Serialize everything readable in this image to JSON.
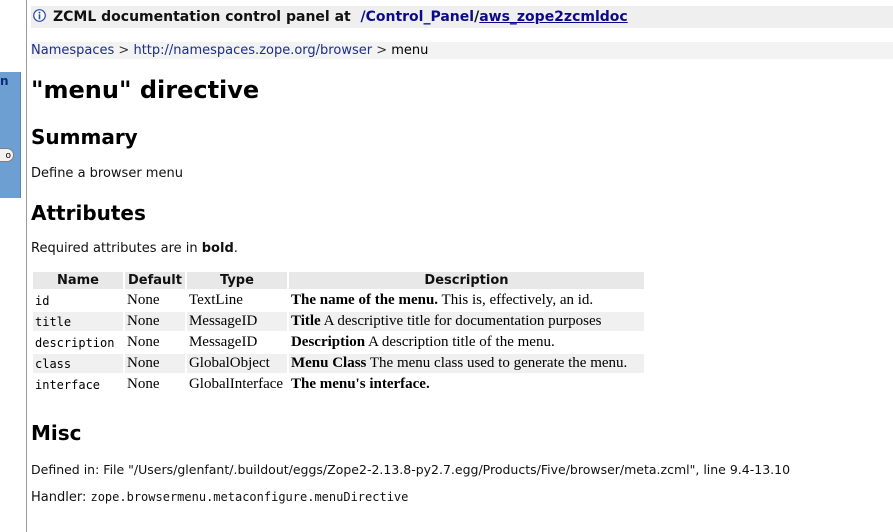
{
  "left_panel": {
    "letter_fragment": "n",
    "button_fragment": "o"
  },
  "header": {
    "prefix": "ZCML documentation control panel at",
    "link_control_panel": "/Control_Panel",
    "slash": "/",
    "link_doc": "aws_zope2zcmldoc"
  },
  "breadcrumb": {
    "item1": "Namespaces",
    "sep": ">",
    "item2": "http://namespaces.zope.org/browser",
    "item3": "menu"
  },
  "page": {
    "title": "\"menu\" directive"
  },
  "summary": {
    "heading": "Summary",
    "text": "Define a browser menu"
  },
  "attributes": {
    "heading": "Attributes",
    "note_prefix": "Required attributes are in",
    "note_bold": "bold",
    "note_suffix": ".",
    "columns": [
      "Name",
      "Default",
      "Type",
      "Description"
    ],
    "rows": [
      {
        "name": "id",
        "default": "None",
        "type": "TextLine",
        "desc_bold": "The name of the menu.",
        "desc": " This is, effectively, an id."
      },
      {
        "name": "title",
        "default": "None",
        "type": "MessageID",
        "desc_bold": "Title",
        "desc": " A descriptive title for documentation purposes"
      },
      {
        "name": "description",
        "default": "None",
        "type": "MessageID",
        "desc_bold": "Description",
        "desc": " A description title of the menu."
      },
      {
        "name": "class",
        "default": "None",
        "type": "GlobalObject",
        "desc_bold": "Menu Class",
        "desc": " The menu class used to generate the menu."
      },
      {
        "name": "interface",
        "default": "None",
        "type": "GlobalInterface",
        "desc_bold": "The menu's interface.",
        "desc": ""
      }
    ]
  },
  "misc": {
    "heading": "Misc",
    "defined_in": "Defined in: File \"/Users/glenfant/.buildout/eggs/Zope2-2.13.8-py2.7.egg/Products/Five/browser/meta.zcml\", line 9.4-13.10",
    "handler_label": "Handler: ",
    "handler_value": "zope.browsermenu.metaconfigure.menuDirective"
  },
  "icons": {
    "info": "info-icon"
  },
  "colors": {
    "link": "#1a2d8c",
    "header_bg": "#efefef",
    "left_panel": "#6d9fd2"
  }
}
